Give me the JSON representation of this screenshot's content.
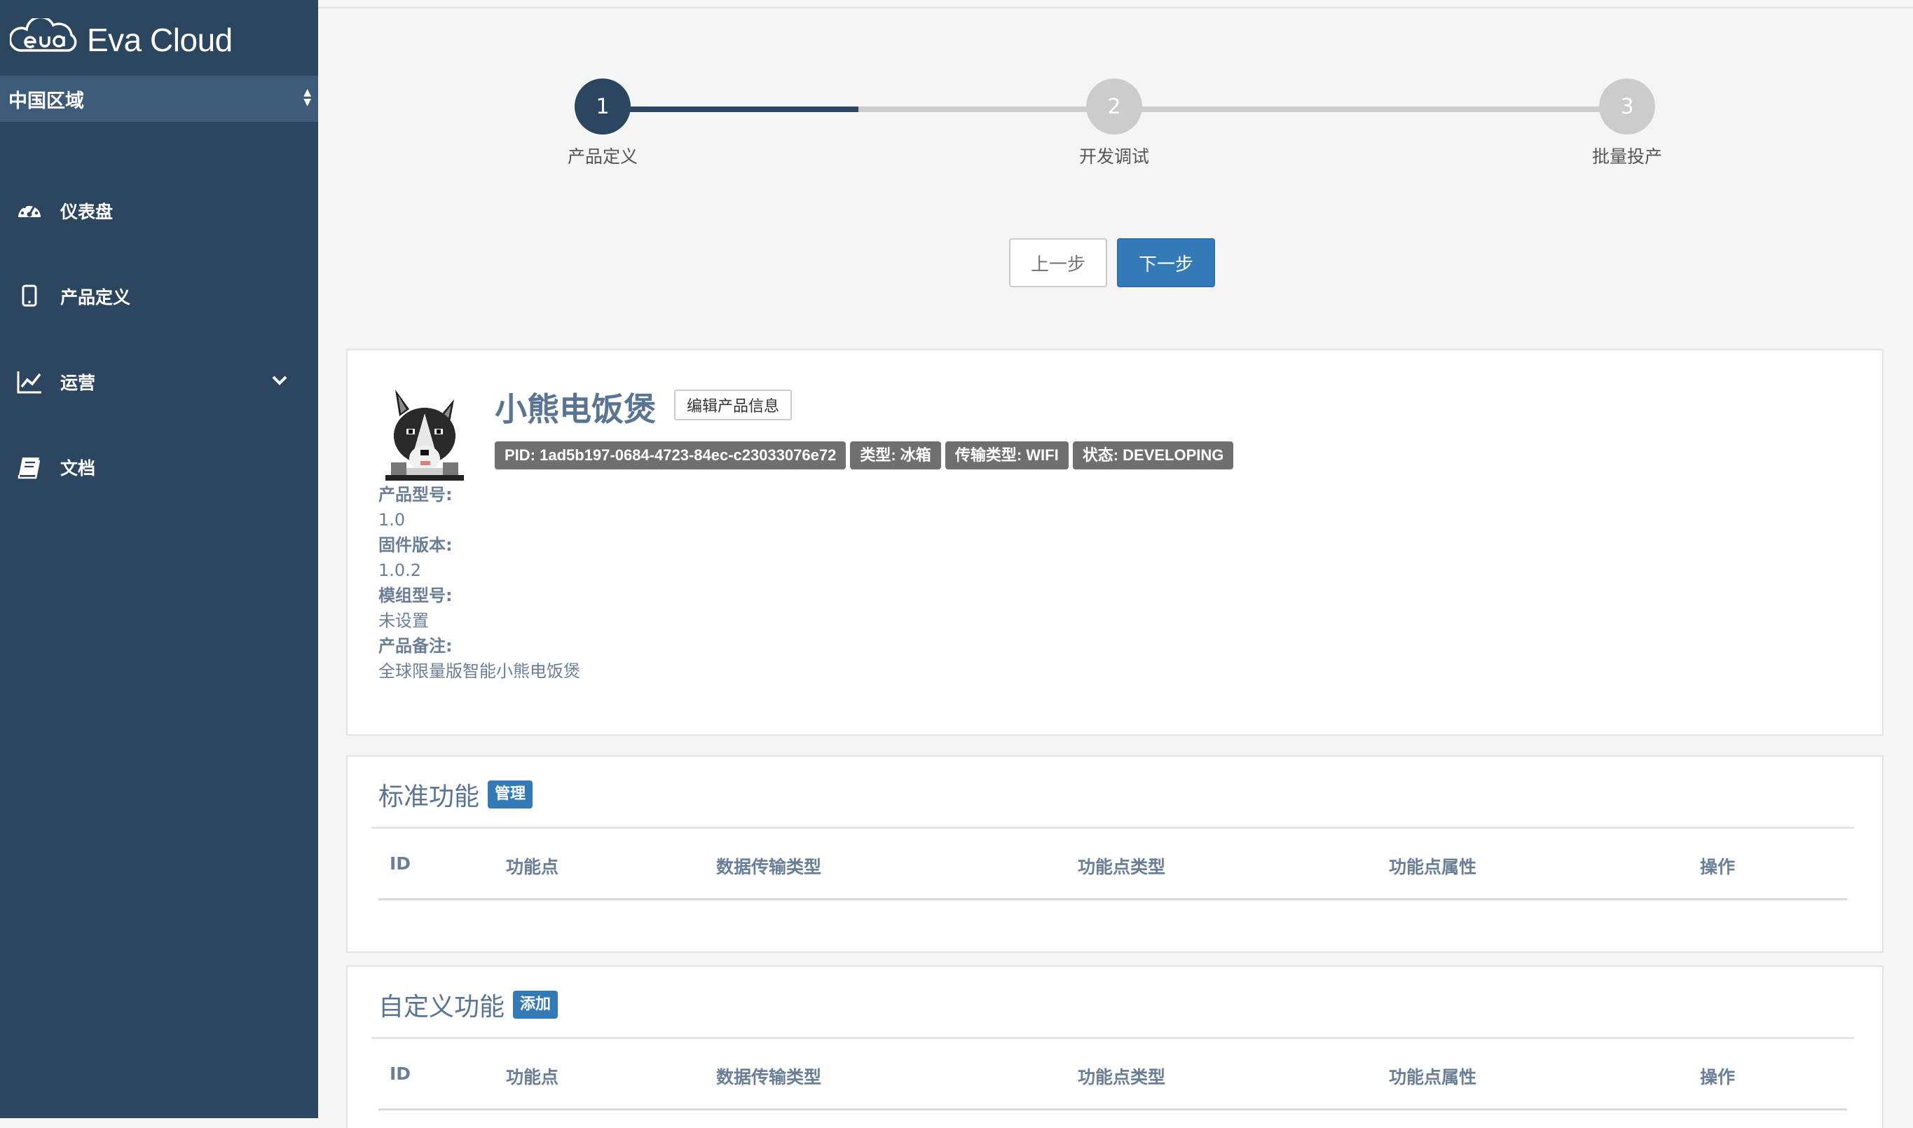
{
  "brand": {
    "name": "Eva Cloud",
    "logo_icon": "eva-cloud-logo"
  },
  "region": {
    "label": "中国区域",
    "icon": "select-caret-icon"
  },
  "sidebar": {
    "items": [
      {
        "label": "仪表盘",
        "icon": "dashboard-icon"
      },
      {
        "label": "产品定义",
        "icon": "tablet-icon"
      },
      {
        "label": "运营",
        "icon": "chart-line-icon",
        "expandable": true
      },
      {
        "label": "文档",
        "icon": "book-icon"
      }
    ]
  },
  "steps": [
    {
      "number": "1",
      "label": "产品定义",
      "active": true
    },
    {
      "number": "2",
      "label": "开发调试",
      "active": false
    },
    {
      "number": "3",
      "label": "批量投产",
      "active": false
    }
  ],
  "step_progress": 0.25,
  "buttons": {
    "prev": "上一步",
    "next": "下一步"
  },
  "product": {
    "name": "小熊电饭煲",
    "edit_label": "编辑产品信息",
    "badges": [
      "PID: 1ad5b197-0684-4723-84ec-c23033076e72",
      "类型: 冰箱",
      "传输类型: WIFI",
      "状态: DEVELOPING"
    ],
    "meta": [
      {
        "label": "产品型号:",
        "value": "1.0"
      },
      {
        "label": "固件版本:",
        "value": "1.0.2"
      },
      {
        "label": "模组型号:",
        "value": "未设置"
      },
      {
        "label": "产品备注:",
        "value": "全球限量版智能小熊电饭煲"
      }
    ]
  },
  "standard_features": {
    "title": "标准功能",
    "action": "管理",
    "columns": [
      "ID",
      "功能点",
      "数据传输类型",
      "功能点类型",
      "功能点属性",
      "操作"
    ]
  },
  "custom_features": {
    "title": "自定义功能",
    "action": "添加",
    "columns": [
      "ID",
      "功能点",
      "数据传输类型",
      "功能点类型",
      "功能点属性",
      "操作"
    ]
  },
  "colors": {
    "sidebar": "#2d4660",
    "region_bar": "#3d5a78",
    "primary": "#337ab7",
    "badge": "#6f6f6f"
  }
}
